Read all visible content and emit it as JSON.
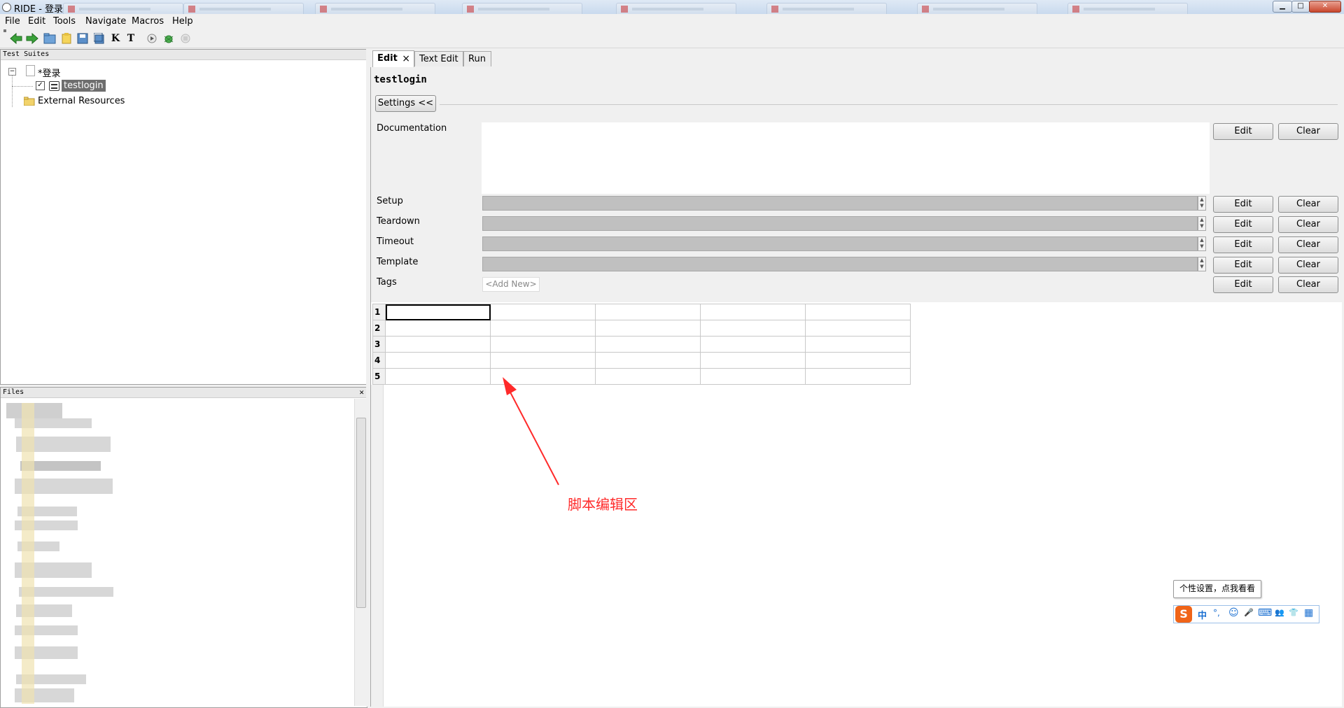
{
  "window": {
    "title": "RIDE - 登录",
    "min_symbol": "▁",
    "max_symbol": "□",
    "close_symbol": "✕"
  },
  "menu": [
    "File",
    "Edit",
    "Tools",
    "Navigate",
    "Macros",
    "Help"
  ],
  "toolbar_icons": [
    "back-icon",
    "forward-icon",
    "open-folder-icon",
    "open-directory-icon",
    "save-icon",
    "save-all-icon",
    "search-keywords-icon",
    "search-tests-icon",
    "run-icon",
    "debug-icon",
    "stop-icon"
  ],
  "toolbar_glyphs": {
    "k": "K",
    "t": "T"
  },
  "test_suites": {
    "header": "Test Suites",
    "root_label": "*登录",
    "testcase_label": "testlogin",
    "external_resources": "External Resources",
    "collapse_glyph": "−",
    "checkbox_glyph": "✓"
  },
  "files": {
    "header": "Files",
    "close_glyph": "✕"
  },
  "tabs": [
    {
      "label": "Edit",
      "active": true
    },
    {
      "label": "Text Edit",
      "active": false
    },
    {
      "label": "Run",
      "active": false
    }
  ],
  "tab_close_glyph": "×",
  "editor": {
    "name": "testlogin",
    "settings_button": "Settings <<",
    "settings": [
      {
        "label": "Documentation",
        "edit": "Edit",
        "clear": "Clear"
      },
      {
        "label": "Setup",
        "edit": "Edit",
        "clear": "Clear"
      },
      {
        "label": "Teardown",
        "edit": "Edit",
        "clear": "Clear"
      },
      {
        "label": "Timeout",
        "edit": "Edit",
        "clear": "Clear"
      },
      {
        "label": "Template",
        "edit": "Edit",
        "clear": "Clear"
      },
      {
        "label": "Tags",
        "edit": "Edit",
        "clear": "Clear",
        "placeholder": "<Add New>"
      }
    ],
    "grid_rows": [
      "1",
      "2",
      "3",
      "4",
      "5"
    ],
    "spin_up": "▲",
    "spin_down": "▼"
  },
  "annotation": {
    "text": "脚本编辑区",
    "color": "#ff2a2a"
  },
  "ime": {
    "tooltip": "个性设置，点我看看",
    "logo": "S",
    "items": [
      "中",
      "°,",
      "☺",
      "🎤",
      "⌨",
      "👥",
      "👕",
      "▦"
    ],
    "color": "#1a6fd1"
  }
}
